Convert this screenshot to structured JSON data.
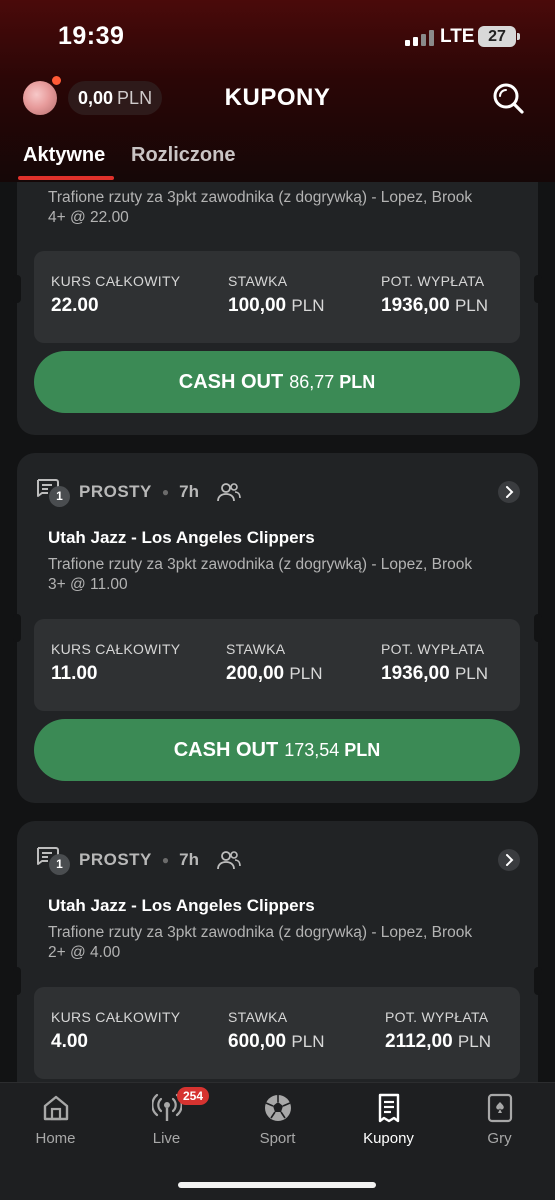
{
  "status_bar": {
    "time": "19:39",
    "network": "LTE",
    "battery": "27"
  },
  "header": {
    "balance_amount": "0,00",
    "balance_currency": "PLN",
    "title": "KUPONY",
    "search_icon": "search-icon"
  },
  "tabs": [
    {
      "label": "Aktywne",
      "active": true
    },
    {
      "label": "Rozliczone",
      "active": false
    }
  ],
  "coupons": [
    {
      "selection": "Trafione rzuty za 3pkt zawodnika (z dogrywką) - Lopez, Brook 4+ @ 22.00",
      "summary": {
        "odds_label": "KURS CAŁKOWITY",
        "odds": "22.00",
        "stake_label": "STAWKA",
        "stake": "100,00",
        "stake_cur": "PLN",
        "payout_label": "POT. WYPŁATA",
        "payout": "1936,00",
        "payout_cur": "PLN"
      },
      "cashout": {
        "label": "CASH OUT",
        "amount": "86,77",
        "currency": "PLN"
      }
    },
    {
      "count": "1",
      "type": "PROSTY",
      "time": "7h",
      "match": "Utah Jazz - Los Angeles Clippers",
      "selection": "Trafione rzuty za 3pkt zawodnika (z dogrywką) - Lopez, Brook 3+ @ 11.00",
      "summary": {
        "odds_label": "KURS CAŁKOWITY",
        "odds": "11.00",
        "stake_label": "STAWKA",
        "stake": "200,00",
        "stake_cur": "PLN",
        "payout_label": "POT. WYPŁATA",
        "payout": "1936,00",
        "payout_cur": "PLN"
      },
      "cashout": {
        "label": "CASH OUT",
        "amount": "173,54",
        "currency": "PLN"
      }
    },
    {
      "count": "1",
      "type": "PROSTY",
      "time": "7h",
      "match": "Utah Jazz - Los Angeles Clippers",
      "selection": "Trafione rzuty za 3pkt zawodnika (z dogrywką) - Lopez, Brook 2+ @ 4.00",
      "summary": {
        "odds_label": "KURS CAŁKOWITY",
        "odds": "4.00",
        "stake_label": "STAWKA",
        "stake": "600,00",
        "stake_cur": "PLN",
        "payout_label": "POT. WYPŁATA",
        "payout": "2112,00",
        "payout_cur": "PLN"
      }
    }
  ],
  "bottom_nav": [
    {
      "label": "Home",
      "icon": "home-icon"
    },
    {
      "label": "Live",
      "icon": "live-icon",
      "badge": "254"
    },
    {
      "label": "Sport",
      "icon": "soccer-ball-icon"
    },
    {
      "label": "Kupony",
      "icon": "receipt-icon",
      "active": true
    },
    {
      "label": "Gry",
      "icon": "playing-card-icon"
    }
  ],
  "colors": {
    "accent": "#e0312b",
    "cashout": "#3b8a55",
    "badge": "#d63330"
  }
}
